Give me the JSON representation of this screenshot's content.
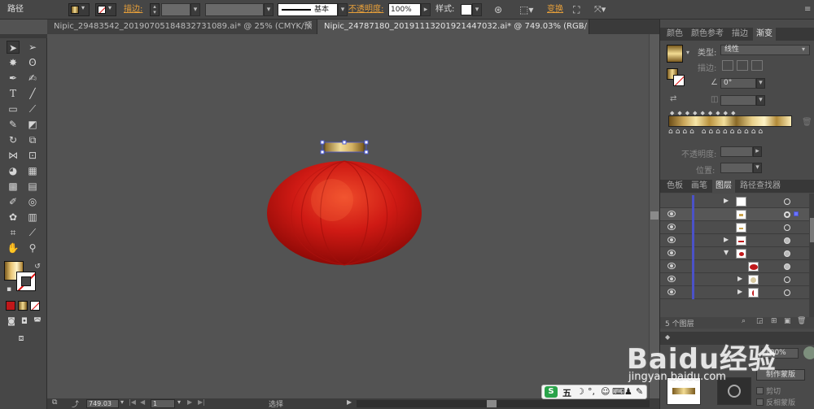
{
  "control_bar": {
    "object_type": "路径",
    "stroke_label": "描边",
    "stroke_line_label": "基本",
    "opacity_label": "不透明度",
    "opacity_value": "100%",
    "style_label": "样式",
    "transform_label": "变换"
  },
  "doc_tabs": [
    {
      "title": "Nipic_29483542_20190705184832731089.ai* @ 25% (CMYK/预览)",
      "close": "×"
    },
    {
      "title": "Nipic_24787180_20191113201921447032.ai* @ 749.03% (RGB/预览)",
      "close": "×"
    }
  ],
  "status_bar": {
    "zoom": "749.03",
    "page": "1",
    "mode": "选择"
  },
  "panels_top": {
    "tabs": [
      "颜色",
      "颜色参考",
      "描边",
      "渐变"
    ],
    "type_label": "类型",
    "type_value": "线性",
    "stroke_label": "描边",
    "angle_value": "0°",
    "opacity_label": "不透明度",
    "position_label": "位置"
  },
  "panels_layers": {
    "tabs": [
      "色板",
      "画笔",
      "图层",
      "路径查找器"
    ],
    "count_label": "5 个图层"
  },
  "panels_bottom": {
    "opacity_value": "100%",
    "make_mask": "制作蒙版",
    "clip": "剪切",
    "invert_mask": "反相蒙版"
  },
  "ime": {
    "label": "五"
  },
  "watermark": {
    "line1": "Baidu经验",
    "line2": "jingyan.baidu.com"
  },
  "colors": {
    "accent_orange": "#e8a03a",
    "layer_blue": "#4b52c8",
    "lantern_red": "#d11a14"
  }
}
